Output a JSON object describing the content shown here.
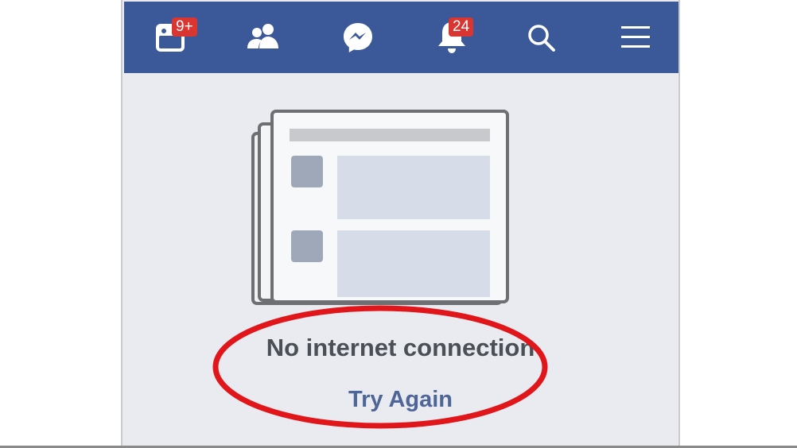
{
  "navbar": {
    "background": "#3b5998",
    "items": [
      {
        "name": "news-feed",
        "icon": "news-feed-icon",
        "badge": "9+"
      },
      {
        "name": "friends",
        "icon": "friends-icon",
        "badge": ""
      },
      {
        "name": "messenger",
        "icon": "messenger-icon",
        "badge": ""
      },
      {
        "name": "notifications",
        "icon": "bell-icon",
        "badge": "24"
      },
      {
        "name": "search",
        "icon": "search-icon",
        "badge": ""
      },
      {
        "name": "menu",
        "icon": "menu-icon",
        "badge": ""
      }
    ]
  },
  "content": {
    "illustration": "newspaper-icon",
    "message": "No internet connection",
    "retry_label": "Try Again",
    "message_color": "#4b4f56",
    "link_color": "#4d6597"
  },
  "annotation": {
    "shape": "red-ellipse-highlight",
    "color": "#e0161a"
  }
}
